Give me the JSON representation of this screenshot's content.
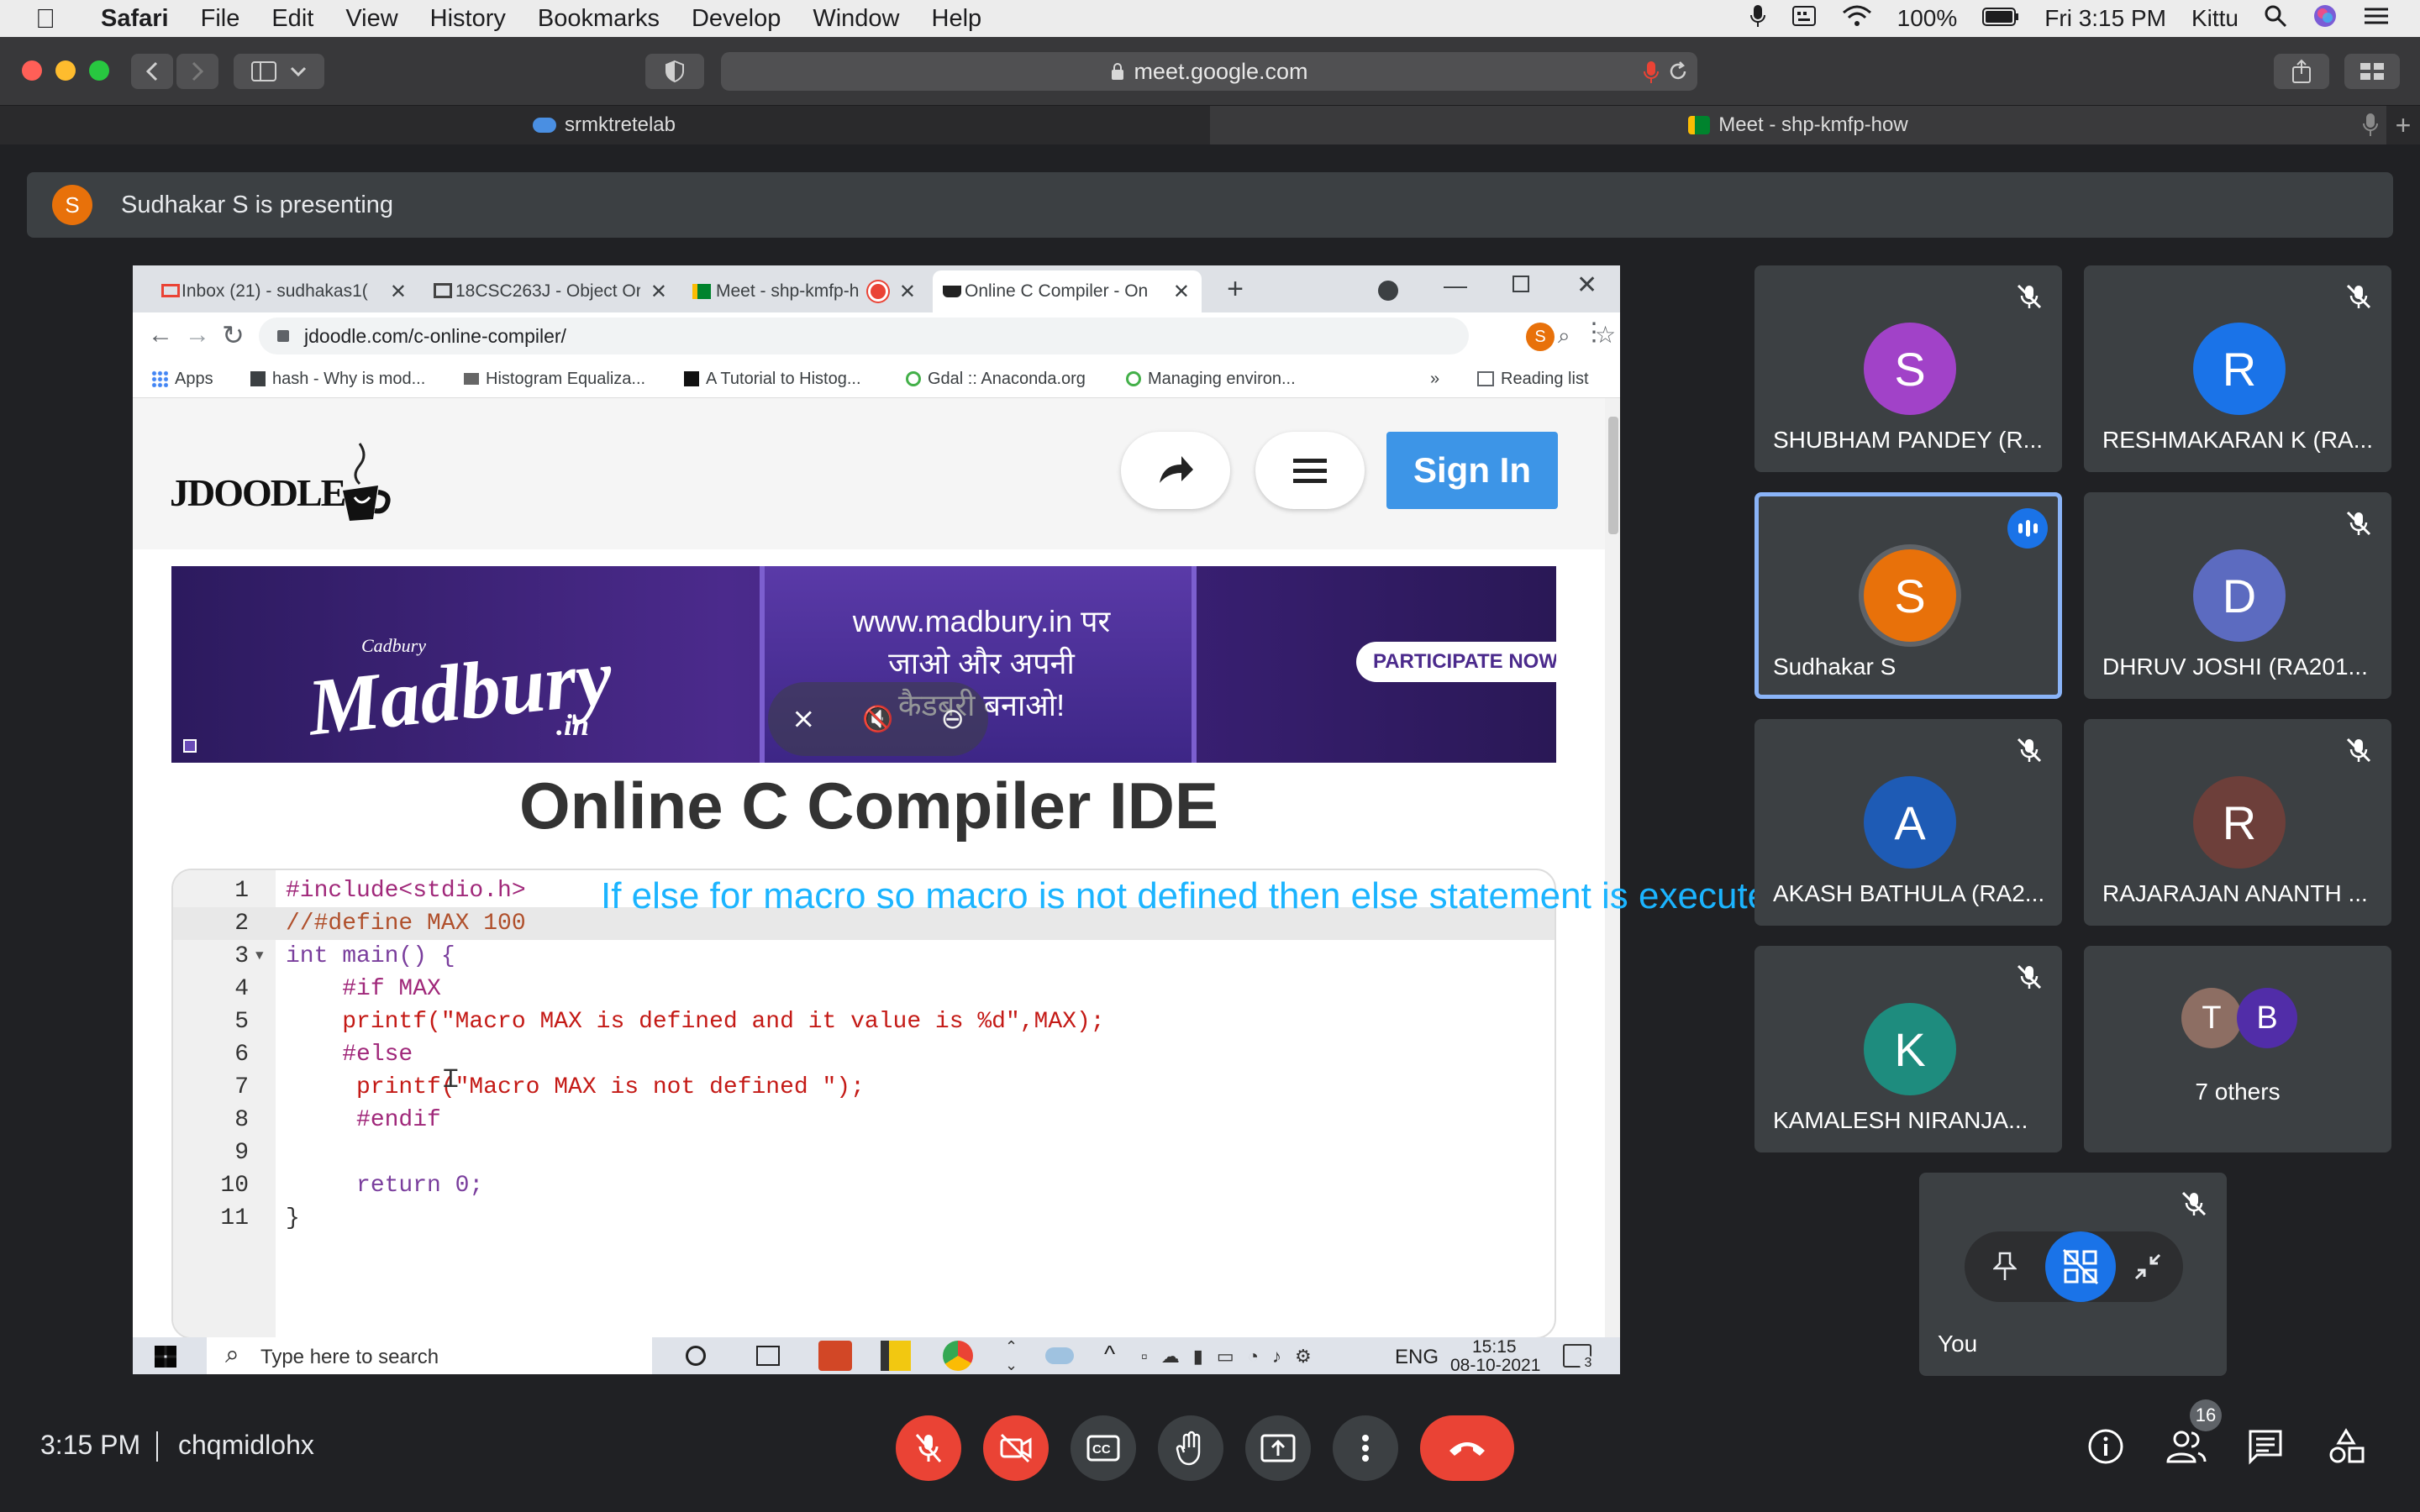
{
  "mac_menubar": {
    "app": "Safari",
    "items": [
      "File",
      "Edit",
      "View",
      "History",
      "Bookmarks",
      "Develop",
      "Window",
      "Help"
    ],
    "battery": "100%",
    "clock": "Fri 3:15 PM",
    "user": "Kittu"
  },
  "safari": {
    "address": "meet.google.com",
    "tabs": [
      {
        "label": "srmktretelab"
      },
      {
        "label": "Meet - shp-kmfp-how"
      }
    ]
  },
  "banner": {
    "initial": "S",
    "text": "Sudhakar S is presenting"
  },
  "presentation": {
    "chrome_tabs": [
      {
        "label": "Inbox (21) - sudhakas1("
      },
      {
        "label": "18CSC263J - Object Or"
      },
      {
        "label": "Meet - shp-kmfp-h"
      },
      {
        "label": "Online C Compiler - On"
      }
    ],
    "url": "jdoodle.com/c-online-compiler/",
    "profile_initial": "S",
    "bookmarks": [
      "Apps",
      "hash - Why is mod...",
      "Histogram Equaliza...",
      "A Tutorial to Histog...",
      "Gdal :: Anaconda.org",
      "Managing environ..."
    ],
    "reading_list": "Reading list",
    "more_bookmarks": "»",
    "logo": "JDOODLE",
    "sign_in": "Sign In",
    "ad": {
      "brand": "Madbury",
      "brand_sub": ".in",
      "cadbury": "Cadbury",
      "line1": "www.madbury.in पर",
      "line2": "जाओ और अपनी",
      "line3": "कैडबरी बनाओ!",
      "cta": "PARTICIPATE NOW"
    },
    "ide_title": "Online C Compiler IDE",
    "code": [
      {
        "n": "1",
        "t": "#include<stdio.h>"
      },
      {
        "n": "2",
        "t": "//#define MAX 100"
      },
      {
        "n": "3",
        "t": "int main() {"
      },
      {
        "n": "4",
        "t": "    #if MAX"
      },
      {
        "n": "5",
        "t": "    printf(\"Macro MAX is defined and it value is %d\",MAX);"
      },
      {
        "n": "6",
        "t": "    #else"
      },
      {
        "n": "7",
        "t": "     printf(\"Macro MAX is not defined \");"
      },
      {
        "n": "8",
        "t": "     #endif"
      },
      {
        "n": "9",
        "t": ""
      },
      {
        "n": "10",
        "t": "     return 0;"
      },
      {
        "n": "11",
        "t": "}"
      }
    ],
    "taskbar": {
      "search_placeholder": "Type here to search",
      "lang": "ENG",
      "time": "15:15",
      "date": "08-10-2021",
      "notif_count": "3"
    }
  },
  "caption": "If else for macro so macro is not defined then else statement is executed",
  "participants": [
    {
      "name": "SHUBHAM PANDEY (R...",
      "initial": "S",
      "color": "#a142c8"
    },
    {
      "name": "RESHMAKARAN K (RA...",
      "initial": "R",
      "color": "#1a73e8"
    },
    {
      "name": "Sudhakar S",
      "initial": "S",
      "color": "#e8710a"
    },
    {
      "name": "DHRUV JOSHI (RA201...",
      "initial": "D",
      "color": "#5c6bc0"
    },
    {
      "name": "AKASH BATHULA (RA2...",
      "initial": "A",
      "color": "#1e5bb5"
    },
    {
      "name": "RAJARAJAN ANANTH ...",
      "initial": "R",
      "color": "#6d3f3a"
    },
    {
      "name": "KAMALESH NIRANJA...",
      "initial": "K",
      "color": "#1e8c7e"
    }
  ],
  "others": {
    "label": "7 others",
    "initials": [
      "T",
      "B"
    ],
    "colors": [
      "#8d6e63",
      "#512da8"
    ]
  },
  "self_tile": {
    "name": "You"
  },
  "meeting": {
    "time": "3:15 PM",
    "code": "chqmidlohx",
    "people_count": "16"
  },
  "colors": {
    "meet_bg": "#202124",
    "tile": "#3c4043",
    "danger": "#ea4335",
    "speaking": "#8ab4f8"
  }
}
